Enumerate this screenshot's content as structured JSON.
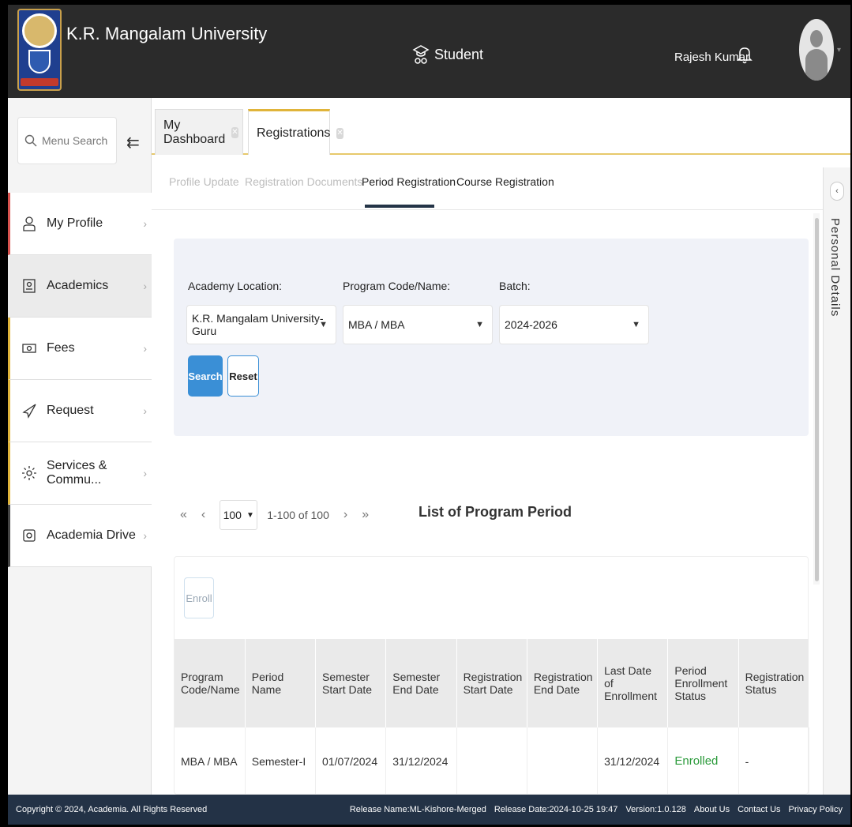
{
  "header": {
    "brand": "K.R. Mangalam University",
    "role": "Student",
    "user_name": "Rajesh Kumar"
  },
  "sidebar": {
    "search_placeholder": "Menu Search",
    "items": [
      {
        "label": "My Profile",
        "icon": "user-icon"
      },
      {
        "label": "Academics",
        "icon": "id-card-icon"
      },
      {
        "label": "Fees",
        "icon": "money-icon"
      },
      {
        "label": "Request",
        "icon": "send-icon"
      },
      {
        "label": "Services & Commu...",
        "icon": "gear-icon"
      },
      {
        "label": "Academia Drive",
        "icon": "drive-icon"
      }
    ]
  },
  "tabs": [
    {
      "label": "My Dashboard"
    },
    {
      "label": "Registrations"
    }
  ],
  "subtabs": [
    "Profile Update",
    "Registration Documents",
    "Period Registration",
    "Course Registration"
  ],
  "filters": {
    "location_label": "Academy Location:",
    "location_value": "K.R. Mangalam University-Guru",
    "program_label": "Program Code/Name:",
    "program_value": "MBA / MBA",
    "batch_label": "Batch:",
    "batch_value": "2024-2026",
    "search_label": "Search",
    "reset_label": "Reset"
  },
  "pager": {
    "first": "«",
    "prev": "‹",
    "page_size": "100",
    "range": "1-100 of 100",
    "next": "›",
    "last": "»"
  },
  "list_title": "List of Program Period",
  "enroll_label": "Enroll",
  "table": {
    "headers": [
      "Program Code/Name",
      "Period Name",
      "Semester Start Date",
      "Semester End Date",
      "Registration Start Date",
      "Registration End Date",
      "Last Date of Enrollment",
      "Period Enrollment Status",
      "Registration Status"
    ],
    "rows": [
      [
        "MBA / MBA",
        "Semester-I",
        "01/07/2024",
        "31/12/2024",
        "",
        "",
        "31/12/2024",
        "Enrolled",
        "-"
      ]
    ]
  },
  "right_panel": {
    "label": "Personal Details"
  },
  "footer": {
    "copyright": "Copyright © 2024, Academia. All Rights Reserved",
    "release_name": "Release Name:ML-Kishore-Merged",
    "release_date": "Release Date:2024-10-25 19:47",
    "version": "Version:1.0.128",
    "about": "About Us",
    "contact": "Contact Us",
    "privacy": "Privacy Policy"
  },
  "colors": {
    "header_bg": "#2b2b2b",
    "accent_blue": "#3a8fd6",
    "tab_gold": "#e0b43a",
    "enrolled_green": "#2a9a3a",
    "footer_bg": "#233246"
  }
}
